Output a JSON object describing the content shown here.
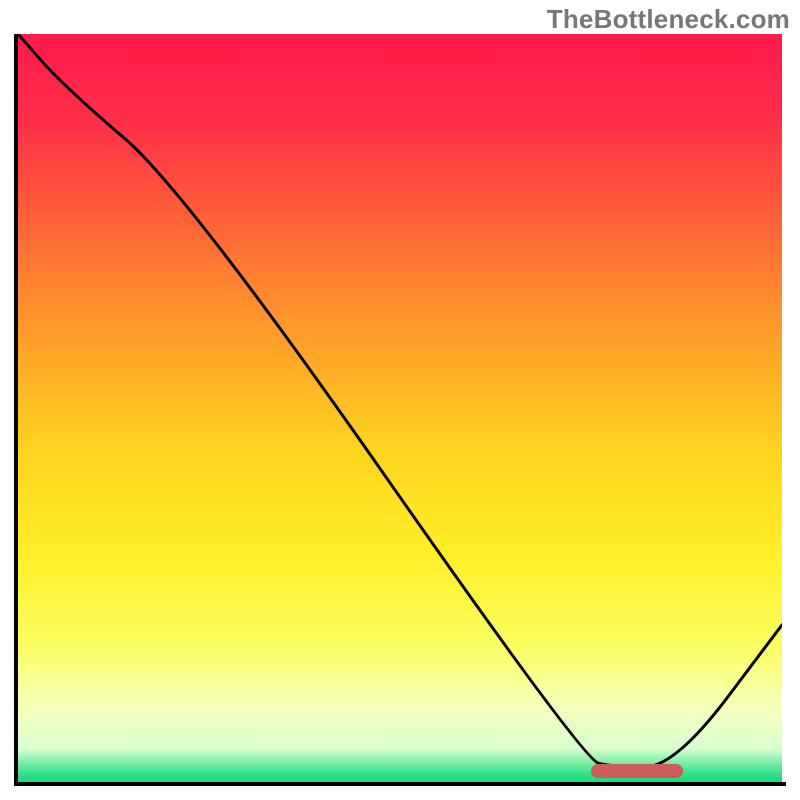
{
  "watermark": "TheBottleneck.com",
  "chart_data": {
    "type": "line",
    "title": "",
    "xlabel": "",
    "ylabel": "",
    "xlim": [
      0,
      100
    ],
    "ylim": [
      0,
      100
    ],
    "x": [
      0,
      6,
      22,
      74,
      78,
      86,
      100
    ],
    "values": [
      100,
      93,
      79,
      3,
      2,
      2,
      21
    ],
    "gradient_stops": [
      {
        "pos": 0.0,
        "color": "#ff1a4b"
      },
      {
        "pos": 0.12,
        "color": "#ff2f47"
      },
      {
        "pos": 0.35,
        "color": "#ff8a2e"
      },
      {
        "pos": 0.55,
        "color": "#ffd21f"
      },
      {
        "pos": 0.7,
        "color": "#fff029"
      },
      {
        "pos": 0.82,
        "color": "#fbff63"
      },
      {
        "pos": 0.9,
        "color": "#f5ffba"
      },
      {
        "pos": 0.955,
        "color": "#d8ffcf"
      },
      {
        "pos": 0.99,
        "color": "#2fe187"
      },
      {
        "pos": 1.0,
        "color": "#17d979"
      }
    ],
    "optimal_marker": {
      "x_start": 75,
      "x_end": 87,
      "y": 1.5
    },
    "notes": "Curve descends from top-left, reaches a flat minimum near x≈74–86, then rises toward the right edge. Background is a vertical red→orange→yellow→green gradient. A small rounded red marker sits at the curve's minimum."
  }
}
